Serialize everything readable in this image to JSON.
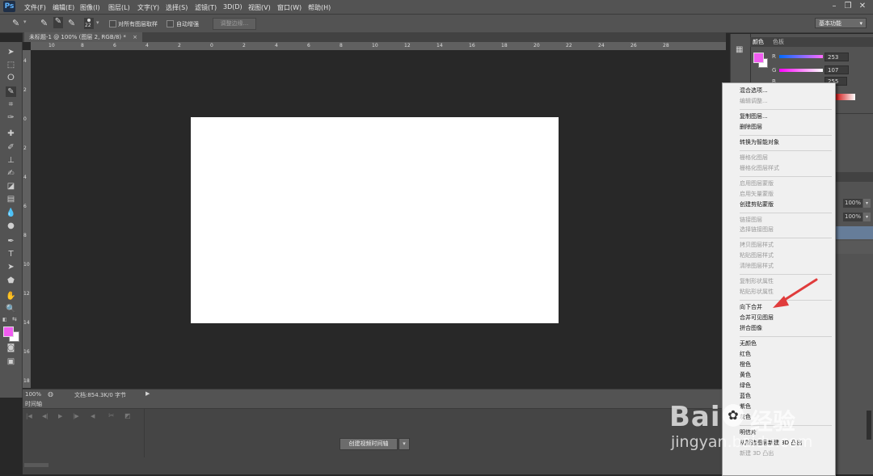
{
  "app": {
    "logo_text": "Ps"
  },
  "menu": {
    "items": [
      "文件(F)",
      "编辑(E)",
      "图像(I)",
      "图层(L)",
      "文字(Y)",
      "选择(S)",
      "滤镜(T)",
      "3D(D)",
      "视图(V)",
      "窗口(W)",
      "帮助(H)"
    ],
    "window_controls": [
      "minimize-icon",
      "restore-icon",
      "close-icon"
    ]
  },
  "options": {
    "brush_size": "22",
    "sample_all_layers": "对所有图层取样",
    "auto_enhance": "自动增强",
    "refine_edge": "调整边缘...",
    "workspace": "基本功能"
  },
  "document": {
    "tab_title": "未标题-1 @ 100% (图层 2, RGB/8) *",
    "zoom": "100%",
    "doc_info": "文档:854.3K/0 字节"
  },
  "rulers": {
    "h_labels": [
      "10",
      "8",
      "6",
      "4",
      "2",
      "0",
      "2",
      "4",
      "6",
      "8",
      "10",
      "12",
      "14",
      "16",
      "18",
      "20",
      "22",
      "24",
      "26",
      "28"
    ],
    "v_labels": [
      "4",
      "2",
      "0",
      "2",
      "4",
      "6",
      "8",
      "10",
      "12",
      "14",
      "16",
      "18"
    ]
  },
  "timeline": {
    "title": "时间轴",
    "create_button": "创建视频时间轴"
  },
  "color_panel": {
    "tabs": [
      "颜色",
      "色板"
    ],
    "channels": [
      {
        "label": "R",
        "value": "253"
      },
      {
        "label": "G",
        "value": "107"
      },
      {
        "label": "B",
        "value": "255"
      }
    ],
    "fg_color": "#f05cf0",
    "layers_opacity": "100%",
    "layers_fill": "100%"
  },
  "context_menu": {
    "groups": [
      [
        {
          "label": "混合选项...",
          "enabled": true
        },
        {
          "label": "编辑调整...",
          "enabled": false
        }
      ],
      [
        {
          "label": "复制图层...",
          "enabled": true
        },
        {
          "label": "删除图层",
          "enabled": true
        }
      ],
      [
        {
          "label": "转换为智能对象",
          "enabled": true
        }
      ],
      [
        {
          "label": "栅格化图层",
          "enabled": false
        },
        {
          "label": "栅格化图层样式",
          "enabled": false
        }
      ],
      [
        {
          "label": "启用图层蒙版",
          "enabled": false
        },
        {
          "label": "启用矢量蒙版",
          "enabled": false
        },
        {
          "label": "创建剪贴蒙版",
          "enabled": true
        }
      ],
      [
        {
          "label": "链接图层",
          "enabled": false
        },
        {
          "label": "选择链接图层",
          "enabled": false
        }
      ],
      [
        {
          "label": "拷贝图层样式",
          "enabled": false
        },
        {
          "label": "粘贴图层样式",
          "enabled": false
        },
        {
          "label": "清除图层样式",
          "enabled": false
        }
      ],
      [
        {
          "label": "复制形状属性",
          "enabled": false
        },
        {
          "label": "粘贴形状属性",
          "enabled": false
        }
      ],
      [
        {
          "label": "向下合并",
          "enabled": true
        },
        {
          "label": "合并可见图层",
          "enabled": true
        },
        {
          "label": "拼合图像",
          "enabled": true
        }
      ],
      [
        {
          "label": "无颜色",
          "enabled": true
        },
        {
          "label": "红色",
          "enabled": true
        },
        {
          "label": "橙色",
          "enabled": true
        },
        {
          "label": "黄色",
          "enabled": true
        },
        {
          "label": "绿色",
          "enabled": true
        },
        {
          "label": "蓝色",
          "enabled": true
        },
        {
          "label": "紫色",
          "enabled": true
        },
        {
          "label": "灰色",
          "enabled": true
        }
      ],
      [
        {
          "label": "明信片",
          "enabled": true
        },
        {
          "label": "从所选图层新建 3D 凸出",
          "enabled": true
        },
        {
          "label": "新建 3D 凸出",
          "enabled": false
        }
      ]
    ]
  },
  "annotation": {
    "arrow_color": "#e03c3c"
  },
  "watermark": {
    "brand": "Bai",
    "brand2": "经验",
    "url": "jingyan.baidu.com"
  }
}
